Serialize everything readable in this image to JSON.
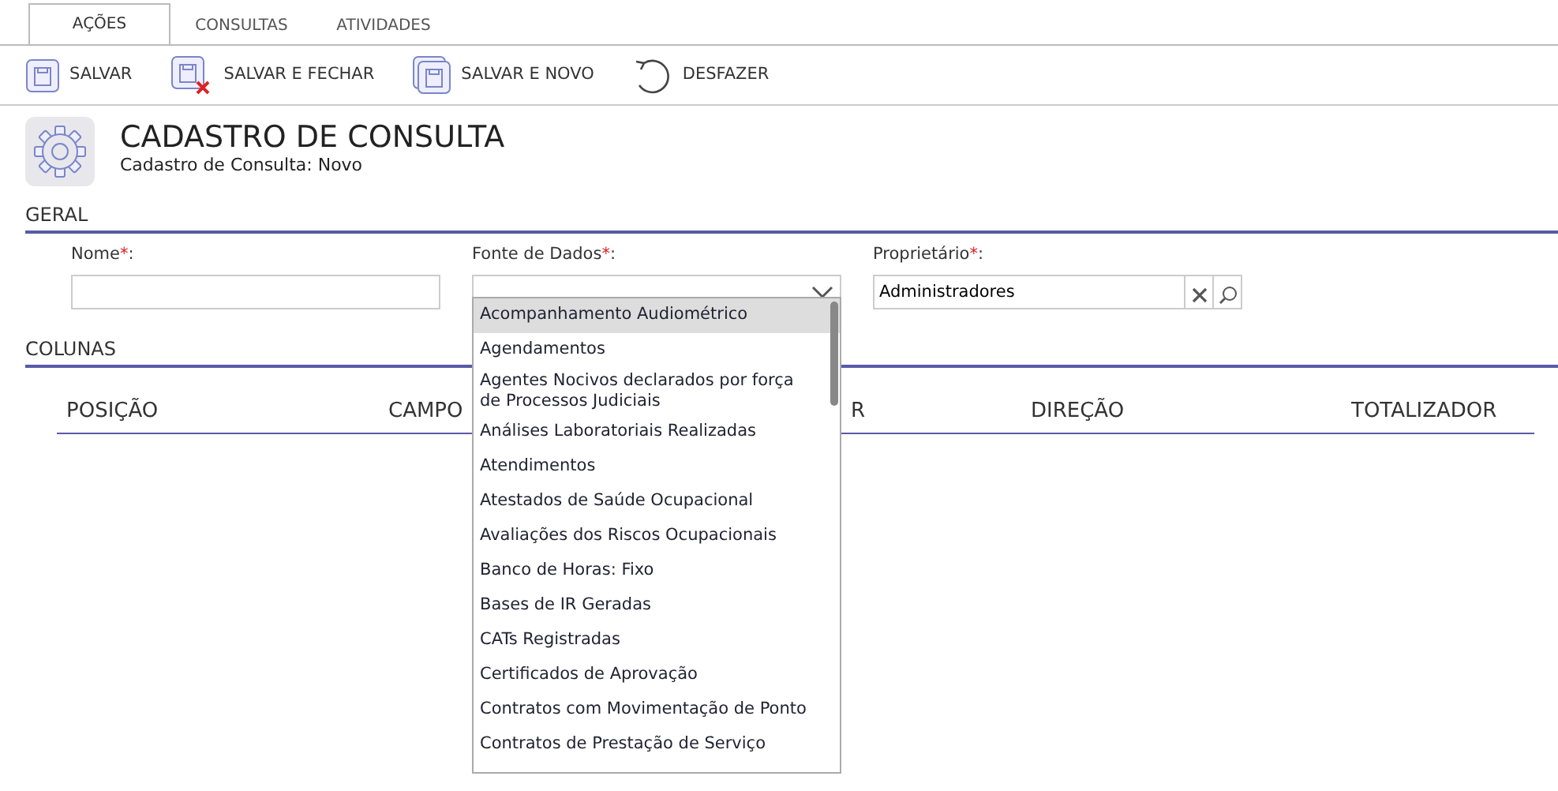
{
  "tabs": [
    {
      "label": "AÇÕES",
      "selected": true
    },
    {
      "label": "CONSULTAS",
      "selected": false
    },
    {
      "label": "ATIVIDADES",
      "selected": false
    }
  ],
  "toolbar": [
    {
      "kind": "save",
      "label": "SALVAR"
    },
    {
      "kind": "save-close",
      "label": "SALVAR E FECHAR"
    },
    {
      "kind": "save-new",
      "label": "SALVAR E NOVO"
    },
    {
      "kind": "undo",
      "label": "DESFAZER"
    }
  ],
  "header": {
    "title": "CADASTRO DE CONSULTA",
    "subtitle": "Cadastro de Consulta: Novo"
  },
  "sections": [
    {
      "title": "GERAL"
    },
    {
      "title": "COLUNAS"
    }
  ],
  "fields": [
    {
      "kind": "text",
      "label": "Nome",
      "required_mark": "*",
      "suffix": ":"
    },
    {
      "kind": "select",
      "label": "Fonte de Dados",
      "required_mark": "*",
      "suffix": ":"
    },
    {
      "kind": "lookup",
      "label": "Proprietário",
      "required_mark": "*",
      "suffix": ":",
      "value": "Administradores"
    }
  ],
  "columns": [
    "POSIÇÃO",
    "CAMPO",
    "R",
    "DIREÇÃO",
    "TOTALIZADOR"
  ],
  "dropdown": {
    "options": [
      {
        "label": "Acompanhamento Audiométrico",
        "selected": true
      },
      {
        "label": "Agendamentos",
        "selected": false
      },
      {
        "label": "Agentes Nocivos declarados por força de Processos Judiciais",
        "selected": false
      },
      {
        "label": "Análises Laboratoriais Realizadas",
        "selected": false
      },
      {
        "label": "Atendimentos",
        "selected": false
      },
      {
        "label": "Atestados de Saúde Ocupacional",
        "selected": false
      },
      {
        "label": "Avaliações dos Riscos Ocupacionais",
        "selected": false
      },
      {
        "label": "Banco de Horas: Fixo",
        "selected": false
      },
      {
        "label": "Bases de IR Geradas",
        "selected": false
      },
      {
        "label": "CATs Registradas",
        "selected": false
      },
      {
        "label": "Certificados de Aprovação",
        "selected": false
      },
      {
        "label": "Contratos com Movimentação de Ponto",
        "selected": false
      },
      {
        "label": "Contratos de Prestação de Serviço",
        "selected": false
      }
    ]
  }
}
